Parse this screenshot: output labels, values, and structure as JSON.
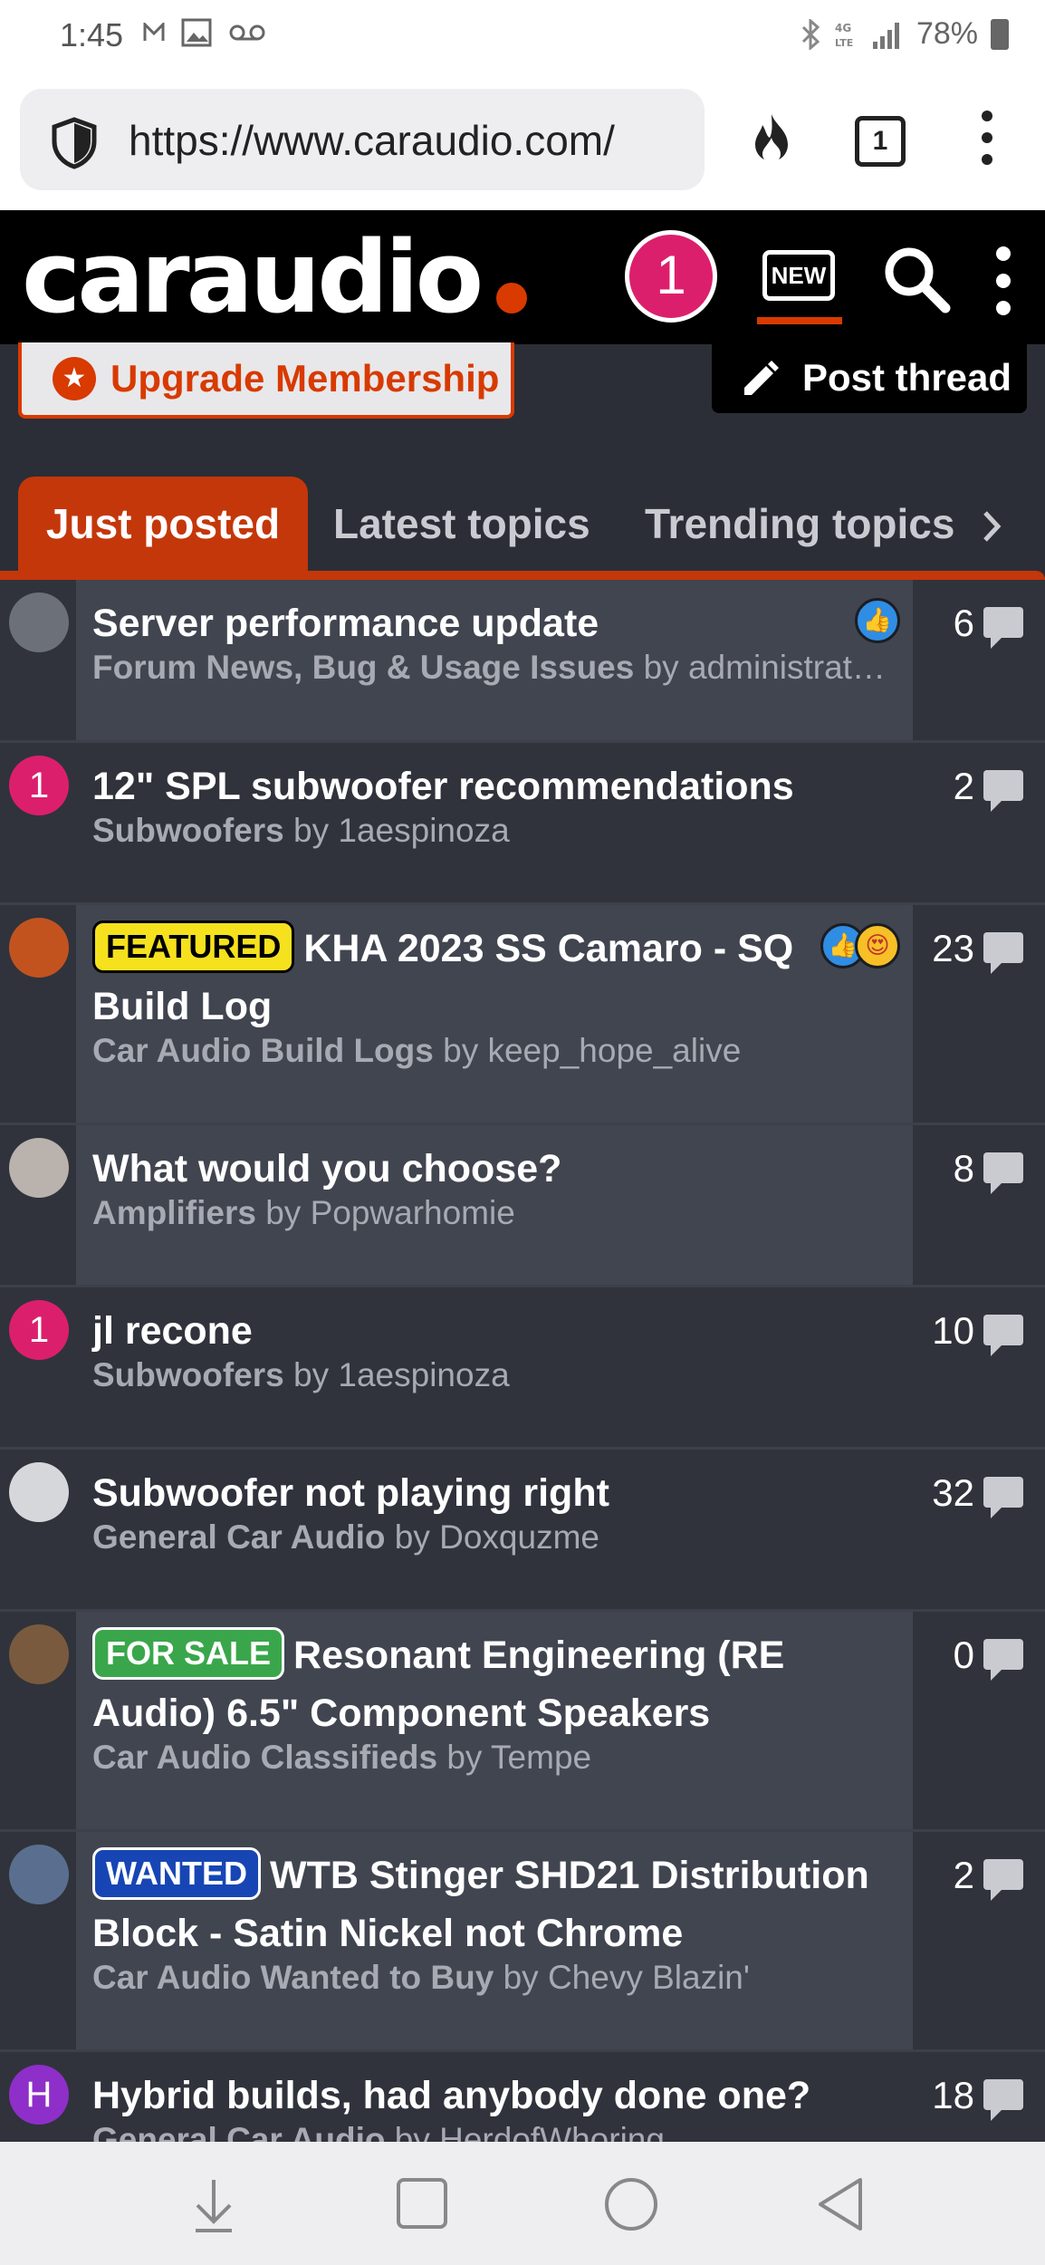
{
  "status_bar": {
    "time": "1:45",
    "battery": "78%",
    "icons": [
      "gmail-icon",
      "gallery-icon",
      "voicemail-icon",
      "bluetooth-icon",
      "4g-lte-icon",
      "signal-icon",
      "battery-icon"
    ]
  },
  "browser": {
    "url": "https://www.caraudio.com/",
    "tab_count": "1"
  },
  "header": {
    "logo": "caraudio",
    "avatar_letter": "1",
    "new_label": "NEW",
    "colors": {
      "brand": "#d83a00",
      "avatar": "#dc1f6d"
    }
  },
  "actions": {
    "upgrade_label": "Upgrade Membership",
    "post_thread_label": "Post thread"
  },
  "tabs": [
    {
      "label": "Just posted",
      "active": true
    },
    {
      "label": "Latest topics",
      "active": false
    },
    {
      "label": "Trending topics",
      "active": false
    }
  ],
  "threads": [
    {
      "title": "Server performance update",
      "forum": "Forum News, Bug & Usage Issues",
      "by": "by",
      "author": "administrat…",
      "count": "6",
      "badge": "",
      "reactions": [
        "like"
      ],
      "avatar": "image",
      "avatar_color": "#6c7078"
    },
    {
      "title": "12\" SPL subwoofer recommendations",
      "forum": "Subwoofers",
      "by": "by",
      "author": "1aespinoza",
      "count": "2",
      "badge": "",
      "reactions": [],
      "avatar": "1",
      "avatar_color": "#dc1f6d"
    },
    {
      "title": "KHA 2023 SS Camaro - SQ Build Log",
      "forum": "Car Audio Build Logs",
      "by": "by",
      "author": "keep_hope_alive",
      "count": "23",
      "badge": "FEATURED",
      "reactions": [
        "like",
        "love"
      ],
      "avatar": "image",
      "avatar_color": "#c2531f"
    },
    {
      "title": "What would you choose?",
      "forum": "Amplifiers",
      "by": "by",
      "author": "Popwarhomie",
      "count": "8",
      "badge": "",
      "reactions": [],
      "avatar": "image",
      "avatar_color": "#b9b2ad"
    },
    {
      "title": "jl recone",
      "forum": "Subwoofers",
      "by": "by",
      "author": "1aespinoza",
      "count": "10",
      "badge": "",
      "reactions": [],
      "avatar": "1",
      "avatar_color": "#dc1f6d"
    },
    {
      "title": "Subwoofer not playing right",
      "forum": "General Car Audio",
      "by": "by",
      "author": "Doxquzme",
      "count": "32",
      "badge": "",
      "reactions": [],
      "avatar": "image",
      "avatar_color": "#d5d7db"
    },
    {
      "title": "Resonant Engineering (RE Audio) 6.5\" Component Speakers",
      "forum": "Car Audio Classifieds",
      "by": "by",
      "author": "Tempe",
      "count": "0",
      "badge": "FOR SALE",
      "reactions": [],
      "avatar": "image",
      "avatar_color": "#7a5a3e"
    },
    {
      "title": "WTB Stinger SHD21 Distribution Block - Satin Nickel not Chrome",
      "forum": "Car Audio Wanted to Buy",
      "by": "by",
      "author": "Chevy Blazin'",
      "count": "2",
      "badge": "WANTED",
      "reactions": [],
      "avatar": "image",
      "avatar_color": "#5a6f8f"
    },
    {
      "title": "Hybrid builds, had anybody done one?",
      "forum": "General Car Audio",
      "by": "by",
      "author": "HerdofWhoring",
      "count": "18",
      "badge": "",
      "reactions": [],
      "avatar": "H",
      "avatar_color": "#8e2fc9"
    }
  ],
  "nav": [
    "download-icon",
    "recents-icon",
    "home-icon",
    "back-icon"
  ]
}
